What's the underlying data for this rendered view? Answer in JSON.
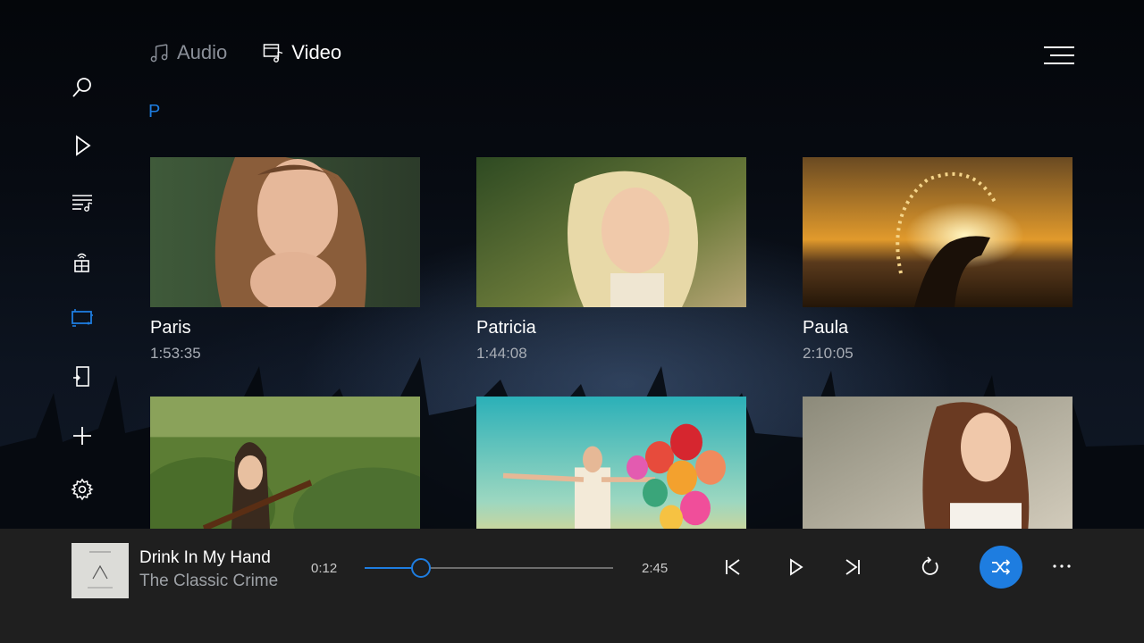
{
  "colors": {
    "accent": "#1e7de0",
    "player_bg": "#1f1f1f"
  },
  "sidebar": {
    "items": [
      {
        "name": "search-icon"
      },
      {
        "name": "play-icon"
      },
      {
        "name": "playlist-icon"
      },
      {
        "name": "network-icon"
      },
      {
        "name": "video-library-icon",
        "active": true
      },
      {
        "name": "device-icon"
      },
      {
        "name": "add-icon"
      },
      {
        "name": "settings-icon"
      }
    ]
  },
  "tabs": [
    {
      "label": "Audio",
      "active": false
    },
    {
      "label": "Video",
      "active": true
    }
  ],
  "letter": "P",
  "videos": [
    {
      "title": "Paris",
      "duration": "1:53:35"
    },
    {
      "title": "Patricia",
      "duration": "1:44:08"
    },
    {
      "title": "Paula",
      "duration": "2:10:05"
    },
    {
      "title": "",
      "duration": ""
    },
    {
      "title": "",
      "duration": ""
    },
    {
      "title": "",
      "duration": ""
    }
  ],
  "player": {
    "title": "Drink In My Hand",
    "artist": "The Classic Crime",
    "current_time": "0:12",
    "total_time": "2:45",
    "progress": 0.225
  }
}
